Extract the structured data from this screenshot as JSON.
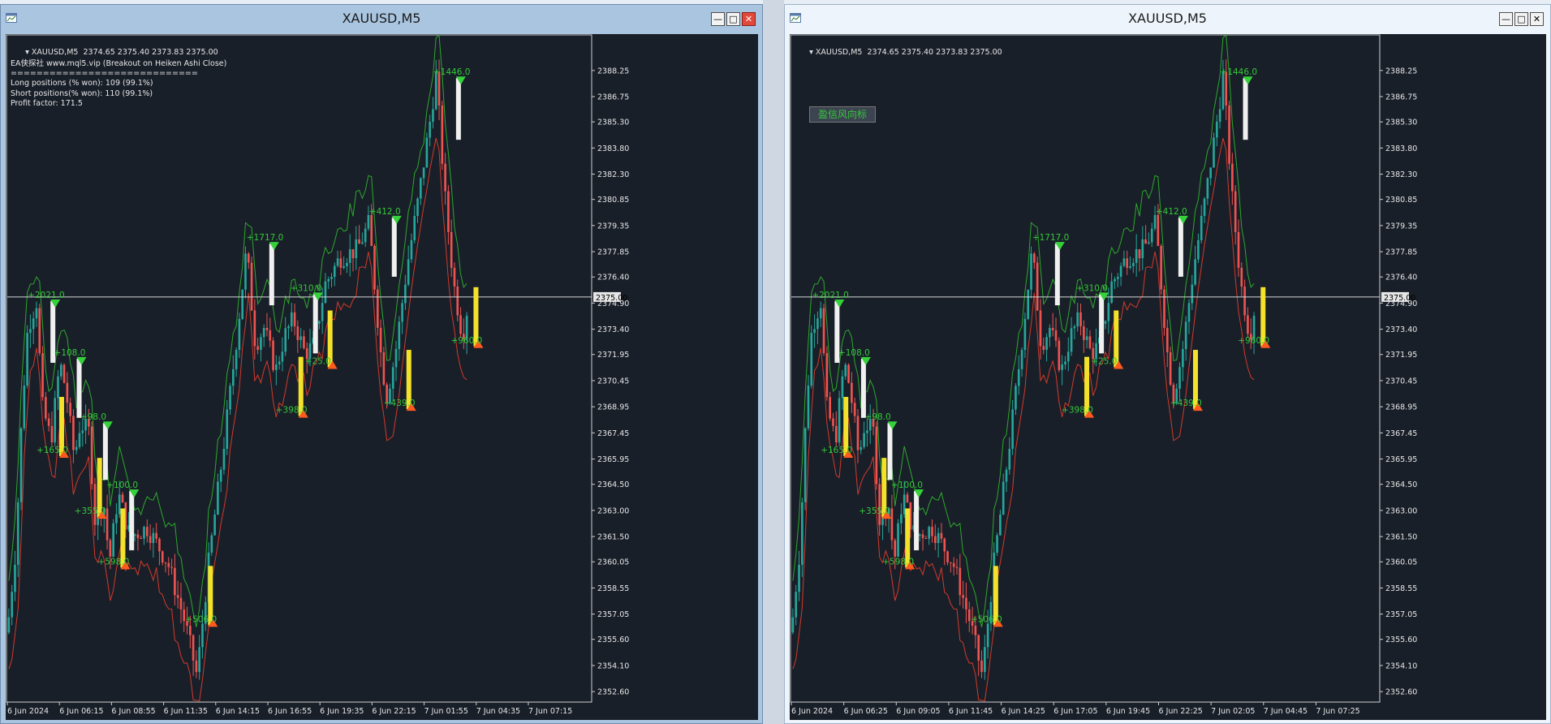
{
  "windows": [
    {
      "title": "XAUUSD,M5",
      "header": "XAUUSD,M5  2374.65 2375.40 2373.83 2375.00",
      "info_lines": [
        "EA侠探社 www.mql5.vip (Breakout on Heiken Ashi Close)",
        "=============================",
        "Long positions (% won): 109 (99.1%)",
        "Short positions(% won): 110 (99.1%)",
        "Profit factor: 171.5"
      ],
      "button_label": "",
      "price_labels": [
        "2388.25",
        "2386.75",
        "2385.30",
        "2383.80",
        "2382.30",
        "2380.85",
        "2379.35",
        "2377.85",
        "2376.40",
        "2374.90",
        "2373.40",
        "2371.95",
        "2370.45",
        "2368.95",
        "2367.45",
        "2365.95",
        "2364.50",
        "2363.00",
        "2361.50",
        "2360.05",
        "2358.55",
        "2357.05",
        "2355.60",
        "2354.10",
        "2352.60"
      ],
      "current_price": "2375.00",
      "time_labels": [
        "6 Jun 2024",
        "6 Jun 06:15",
        "6 Jun 08:55",
        "6 Jun 11:35",
        "6 Jun 14:15",
        "6 Jun 16:55",
        "6 Jun 19:35",
        "6 Jun 22:15",
        "7 Jun 01:55",
        "7 Jun 04:35",
        "7 Jun 07:15"
      ]
    },
    {
      "title": "XAUUSD,M5",
      "header": "XAUUSD,M5  2374.65 2375.40 2373.83 2375.00",
      "info_lines": [],
      "button_label": "盈信风向标",
      "price_labels": [
        "2388.25",
        "2386.75",
        "2385.30",
        "2383.80",
        "2382.30",
        "2380.85",
        "2379.35",
        "2377.85",
        "2376.40",
        "2374.90",
        "2373.40",
        "2371.95",
        "2370.45",
        "2368.95",
        "2367.45",
        "2365.95",
        "2364.50",
        "2363.00",
        "2361.50",
        "2360.05",
        "2358.55",
        "2357.05",
        "2355.60",
        "2354.10",
        "2352.60"
      ],
      "current_price": "2375.00",
      "time_labels": [
        "6 Jun 2024",
        "6 Jun 06:25",
        "6 Jun 09:05",
        "6 Jun 11:45",
        "6 Jun 14:25",
        "6 Jun 17:05",
        "6 Jun 19:45",
        "6 Jun 22:25",
        "7 Jun 02:05",
        "7 Jun 04:45",
        "7 Jun 07:25"
      ]
    }
  ],
  "trade_labels": [
    {
      "text": "+2021.0",
      "price": 2375.2,
      "t": 0.035,
      "side": "short"
    },
    {
      "text": "+108.0",
      "price": 2371.9,
      "t": 0.08,
      "side": "short"
    },
    {
      "text": "+165.0",
      "price": 2366.3,
      "t": 0.05,
      "side": "long"
    },
    {
      "text": "+98.0",
      "price": 2368.2,
      "t": 0.125,
      "side": "short"
    },
    {
      "text": "+355.0",
      "price": 2362.8,
      "t": 0.115,
      "side": "long"
    },
    {
      "text": "+100.0",
      "price": 2364.3,
      "t": 0.17,
      "side": "short"
    },
    {
      "text": "+598.0",
      "price": 2359.9,
      "t": 0.155,
      "side": "long"
    },
    {
      "text": "+506.0",
      "price": 2356.6,
      "t": 0.305,
      "side": "long"
    },
    {
      "text": "+1717.0",
      "price": 2378.5,
      "t": 0.41,
      "side": "short"
    },
    {
      "text": "+310.0",
      "price": 2375.6,
      "t": 0.485,
      "side": "short"
    },
    {
      "text": "+398.0",
      "price": 2368.6,
      "t": 0.46,
      "side": "long"
    },
    {
      "text": "+25.0",
      "price": 2371.4,
      "t": 0.51,
      "side": "long"
    },
    {
      "text": "+412.0",
      "price": 2380.0,
      "t": 0.62,
      "side": "short"
    },
    {
      "text": "+439.0",
      "price": 2369.0,
      "t": 0.645,
      "side": "long"
    },
    {
      "text": "+1446.0",
      "price": 2388.0,
      "t": 0.73,
      "side": "short"
    },
    {
      "text": "+960.0",
      "price": 2372.6,
      "t": 0.76,
      "side": "long"
    }
  ],
  "colors": {
    "background": "#191f29",
    "bull": "#26a69a",
    "bear": "#ef5350",
    "upper_band": "#2ca82c",
    "lower_band": "#d23a2a",
    "profit_text": "#35c83a",
    "long_arrow": "#ff5a1e",
    "short_arrow": "#36d03a",
    "highlight_yellow": "#f4e22a",
    "highlight_white": "#f0f0f0"
  },
  "icons": [
    "chart-window-icon",
    "minimize-icon",
    "maximize-icon",
    "close-icon",
    "dropdown-triangle-icon"
  ]
}
